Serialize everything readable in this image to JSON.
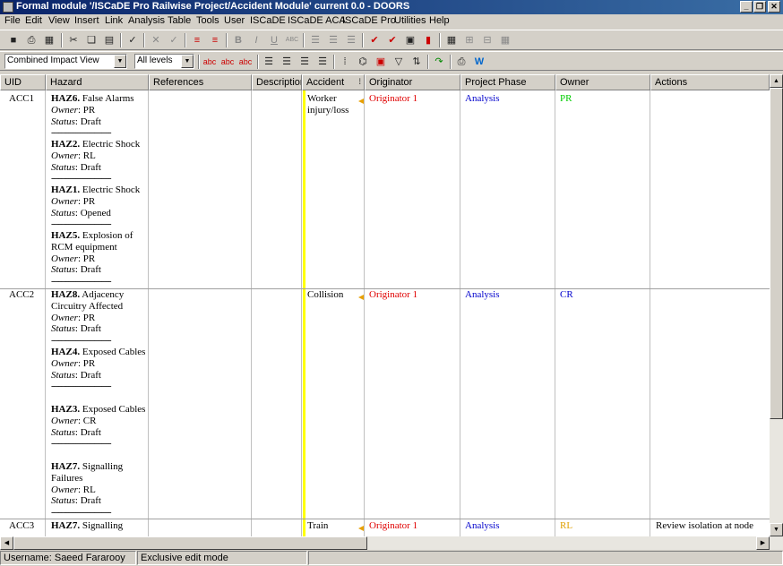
{
  "window": {
    "title": "Formal module '/ISCaDE Pro Railwise Project/Accident Module' current 0.0 - DOORS"
  },
  "menu": [
    "File",
    "Edit",
    "View",
    "Insert",
    "Link",
    "Analysis",
    "Table",
    "Tools",
    "User",
    "ISCaDE",
    "ISCaDE ACA",
    "ISCaDE Pro",
    "Utilities",
    "Help"
  ],
  "toolbar": {
    "view_select": "Combined Impact View",
    "level_select": "All levels"
  },
  "columns": [
    "UID",
    "Hazard",
    "References",
    "Description",
    "Accident",
    "Originator",
    "Project Phase",
    "Owner",
    "Actions"
  ],
  "labels": {
    "owner": "Owner",
    "status": "Status"
  },
  "rows": [
    {
      "uid": "ACC1",
      "accident": "Worker injury/loss",
      "originator": "Originator 1",
      "phase": "Analysis",
      "owner": "PR",
      "action": "",
      "hazards": [
        {
          "id": "HAZ6.",
          "name": "False Alarms",
          "owner": "PR",
          "status": "Draft"
        },
        {
          "id": "HAZ2.",
          "name": "Electric Shock",
          "owner": "RL",
          "status": "Draft"
        },
        {
          "id": "HAZ1.",
          "name": "Electric Shock",
          "owner": "PR",
          "status": "Opened"
        },
        {
          "id": "HAZ5.",
          "name": "Explosion of RCM equipment",
          "owner": "PR",
          "status": "Draft"
        }
      ]
    },
    {
      "uid": "ACC2",
      "accident": "Collision",
      "originator": "Originator 1",
      "phase": "Analysis",
      "owner": "CR",
      "action": "",
      "hazards": [
        {
          "id": "HAZ8.",
          "name": "Adjacency Circuitry Affected",
          "owner": "PR",
          "status": "Draft"
        },
        {
          "id": "HAZ4.",
          "name": "Exposed Cables",
          "owner": "PR",
          "status": "Draft"
        },
        {
          "id": "HAZ3.",
          "name": "Exposed Cables",
          "owner": "CR",
          "status": "Draft"
        },
        {
          "id": "HAZ7.",
          "name": "Signalling Failures",
          "owner": "RL",
          "status": "Draft"
        }
      ]
    },
    {
      "uid": "ACC3",
      "accident": "Train",
      "originator": "Originator 1",
      "phase": "Analysis",
      "owner": "RL",
      "action": "Review isolation at node",
      "hazards": [
        {
          "id": "HAZ7.",
          "name": "Signalling",
          "owner": "",
          "status": ""
        }
      ]
    }
  ],
  "colors": {
    "originator": "#e00000",
    "phase": "#0000cc",
    "owner_pr": "#00cc00",
    "owner_cr": "#0000cc",
    "owner_rl": "#e0a000",
    "accident_col": "#ffff00"
  },
  "status": {
    "username": "Username: Saeed Fararooy",
    "mode": "Exclusive edit mode"
  }
}
